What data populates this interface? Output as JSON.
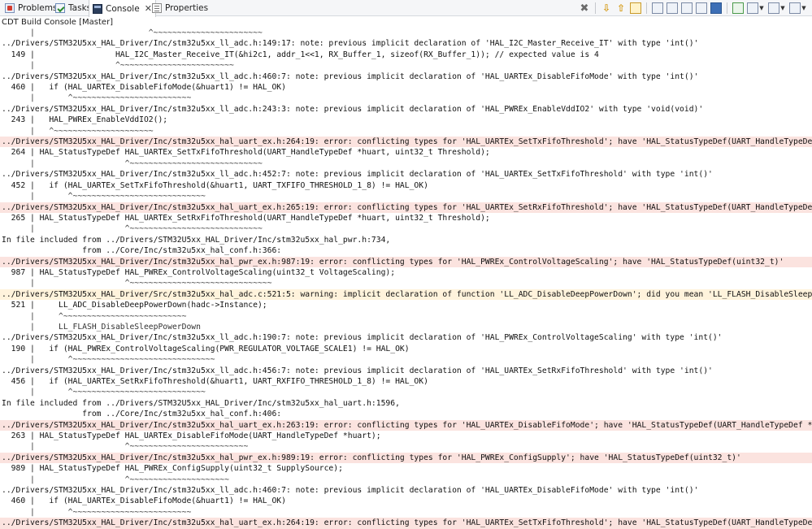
{
  "tabs": [
    {
      "label": "Problems",
      "icon": "problems-icon",
      "active": false
    },
    {
      "label": "Tasks",
      "icon": "tasks-icon",
      "active": false
    },
    {
      "label": "Console",
      "icon": "console-icon",
      "active": true,
      "close": "✕"
    },
    {
      "label": "Properties",
      "icon": "properties-icon",
      "active": false
    }
  ],
  "toolbar": {
    "icons": [
      "terminate-icon",
      "scroll-lock-down-icon",
      "scroll-lock-up-icon",
      "link-icon",
      "clear-console-icon",
      "pin-console-icon",
      "word-wrap-icon",
      "copy-icon",
      "paste-icon",
      "show-console-icon",
      "open-console-icon",
      "display-selected-console-icon",
      "new-console-icon"
    ]
  },
  "console_title": "CDT Build Console [Master]",
  "lines": [
    {
      "kind": "hint",
      "text": "      |                        ^~~~~~~~~~~~~~~~~~~~~~~~"
    },
    {
      "kind": "note",
      "text": "../Drivers/STM32U5xx_HAL_Driver/Inc/stm32u5xx_ll_adc.h:149:17: note: previous implicit declaration of 'HAL_I2C_Master_Receive_IT' with type 'int()'"
    },
    {
      "kind": "code",
      "text": "  149 |                 HAL_I2C_Master_Receive_IT(&hi2c1, addr_1<<1, RX_Buffer_1, sizeof(RX_Buffer_1)); // expected value is 4"
    },
    {
      "kind": "hint",
      "text": "      |                 ^~~~~~~~~~~~~~~~~~~~~~~~~"
    },
    {
      "kind": "note",
      "text": "../Drivers/STM32U5xx_HAL_Driver/Inc/stm32u5xx_ll_adc.h:460:7: note: previous implicit declaration of 'HAL_UARTEx_DisableFifoMode' with type 'int()'"
    },
    {
      "kind": "code",
      "text": "  460 |   if (HAL_UARTEx_DisableFifoMode(&huart1) != HAL_OK)"
    },
    {
      "kind": "hint",
      "text": "      |       ^~~~~~~~~~~~~~~~~~~~~~~~~~"
    },
    {
      "kind": "note",
      "text": "../Drivers/STM32U5xx_HAL_Driver/Inc/stm32u5xx_ll_adc.h:243:3: note: previous implicit declaration of 'HAL_PWREx_EnableVddIO2' with type 'void(void)'"
    },
    {
      "kind": "code",
      "text": "  243 |   HAL_PWREx_EnableVddIO2();"
    },
    {
      "kind": "hint",
      "text": "      |   ^~~~~~~~~~~~~~~~~~~~~~"
    },
    {
      "kind": "error",
      "text": "../Drivers/STM32U5xx_HAL_Driver/Inc/stm32u5xx_hal_uart_ex.h:264:19: error: conflicting types for 'HAL_UARTEx_SetTxFifoThreshold'; have 'HAL_StatusTypeDef(UART_HandleTypeDef *, uint32_t)'"
    },
    {
      "kind": "code",
      "text": "  264 | HAL_StatusTypeDef HAL_UARTEx_SetTxFifoThreshold(UART_HandleTypeDef *huart, uint32_t Threshold);"
    },
    {
      "kind": "hint",
      "text": "      |                   ^~~~~~~~~~~~~~~~~~~~~~~~~~~~~"
    },
    {
      "kind": "note",
      "text": "../Drivers/STM32U5xx_HAL_Driver/Inc/stm32u5xx_ll_adc.h:452:7: note: previous implicit declaration of 'HAL_UARTEx_SetTxFifoThreshold' with type 'int()'"
    },
    {
      "kind": "code",
      "text": "  452 |   if (HAL_UARTEx_SetTxFifoThreshold(&huart1, UART_TXFIFO_THRESHOLD_1_8) != HAL_OK)"
    },
    {
      "kind": "hint",
      "text": "      |       ^~~~~~~~~~~~~~~~~~~~~~~~~~~~~"
    },
    {
      "kind": "error",
      "text": "../Drivers/STM32U5xx_HAL_Driver/Inc/stm32u5xx_hal_uart_ex.h:265:19: error: conflicting types for 'HAL_UARTEx_SetRxFifoThreshold'; have 'HAL_StatusTypeDef(UART_HandleTypeDef *, uint32_t)'"
    },
    {
      "kind": "code",
      "text": "  265 | HAL_StatusTypeDef HAL_UARTEx_SetRxFifoThreshold(UART_HandleTypeDef *huart, uint32_t Threshold);"
    },
    {
      "kind": "hint",
      "text": "      |                   ^~~~~~~~~~~~~~~~~~~~~~~~~~~~~"
    },
    {
      "kind": "info",
      "text": "In file included from ../Drivers/STM32U5xx_HAL_Driver/Inc/stm32u5xx_hal_pwr.h:734,"
    },
    {
      "kind": "info",
      "text": "                 from ../Core/Inc/stm32u5xx_hal_conf.h:366:"
    },
    {
      "kind": "error",
      "text": "../Drivers/STM32U5xx_HAL_Driver/Inc/stm32u5xx_hal_pwr_ex.h:987:19: error: conflicting types for 'HAL_PWREx_ControlVoltageScaling'; have 'HAL_StatusTypeDef(uint32_t)'"
    },
    {
      "kind": "code",
      "text": "  987 | HAL_StatusTypeDef HAL_PWREx_ControlVoltageScaling(uint32_t VoltageScaling);"
    },
    {
      "kind": "hint",
      "text": "      |                   ^~~~~~~~~~~~~~~~~~~~~~~~~~~~~~~"
    },
    {
      "kind": "warning",
      "text": "../Drivers/STM32U5xx_HAL_Driver/Src/stm32u5xx_hal_adc.c:521:5: warning: implicit declaration of function 'LL_ADC_DisableDeepPowerDown'; did you mean 'LL_FLASH_DisableSleepPowerDown'?"
    },
    {
      "kind": "code",
      "text": "  521 |     LL_ADC_DisableDeepPowerDown(hadc->Instance);"
    },
    {
      "kind": "hint",
      "text": "      |     ^~~~~~~~~~~~~~~~~~~~~~~~~~~"
    },
    {
      "kind": "hint",
      "text": "      |     LL_FLASH_DisableSleepPowerDown"
    },
    {
      "kind": "note",
      "text": "../Drivers/STM32U5xx_HAL_Driver/Inc/stm32u5xx_ll_adc.h:190:7: note: previous implicit declaration of 'HAL_PWREx_ControlVoltageScaling' with type 'int()'"
    },
    {
      "kind": "code",
      "text": "  190 |   if (HAL_PWREx_ControlVoltageScaling(PWR_REGULATOR_VOLTAGE_SCALE1) != HAL_OK)"
    },
    {
      "kind": "hint",
      "text": "      |       ^~~~~~~~~~~~~~~~~~~~~~~~~~~~~~~"
    },
    {
      "kind": "note",
      "text": "../Drivers/STM32U5xx_HAL_Driver/Inc/stm32u5xx_ll_adc.h:456:7: note: previous implicit declaration of 'HAL_UARTEx_SetRxFifoThreshold' with type 'int()'"
    },
    {
      "kind": "code",
      "text": "  456 |   if (HAL_UARTEx_SetRxFifoThreshold(&huart1, UART_RXFIFO_THRESHOLD_1_8) != HAL_OK)"
    },
    {
      "kind": "hint",
      "text": "      |       ^~~~~~~~~~~~~~~~~~~~~~~~~~~~~"
    },
    {
      "kind": "info",
      "text": "In file included from ../Drivers/STM32U5xx_HAL_Driver/Inc/stm32u5xx_hal_uart.h:1596,"
    },
    {
      "kind": "info",
      "text": "                 from ../Core/Inc/stm32u5xx_hal_conf.h:406:"
    },
    {
      "kind": "error",
      "text": "../Drivers/STM32U5xx_HAL_Driver/Inc/stm32u5xx_hal_uart_ex.h:263:19: error: conflicting types for 'HAL_UARTEx_DisableFifoMode'; have 'HAL_StatusTypeDef(UART_HandleTypeDef *)'"
    },
    {
      "kind": "code",
      "text": "  263 | HAL_StatusTypeDef HAL_UARTEx_DisableFifoMode(UART_HandleTypeDef *huart);"
    },
    {
      "kind": "hint",
      "text": "      |                   ^~~~~~~~~~~~~~~~~~~~~~~~~~"
    },
    {
      "kind": "error",
      "text": "../Drivers/STM32U5xx_HAL_Driver/Inc/stm32u5xx_hal_pwr_ex.h:989:19: error: conflicting types for 'HAL_PWREx_ConfigSupply'; have 'HAL_StatusTypeDef(uint32_t)'"
    },
    {
      "kind": "code",
      "text": "  989 | HAL_StatusTypeDef HAL_PWREx_ConfigSupply(uint32_t SupplySource);"
    },
    {
      "kind": "hint",
      "text": "      |                   ^~~~~~~~~~~~~~~~~~~~~~"
    },
    {
      "kind": "note",
      "text": "../Drivers/STM32U5xx_HAL_Driver/Inc/stm32u5xx_ll_adc.h:460:7: note: previous implicit declaration of 'HAL_UARTEx_DisableFifoMode' with type 'int()'"
    },
    {
      "kind": "code",
      "text": "  460 |   if (HAL_UARTEx_DisableFifoMode(&huart1) != HAL_OK)"
    },
    {
      "kind": "hint",
      "text": "      |       ^~~~~~~~~~~~~~~~~~~~~~~~~~"
    },
    {
      "kind": "error",
      "text": "../Drivers/STM32U5xx_HAL_Driver/Inc/stm32u5xx_hal_uart_ex.h:264:19: error: conflicting types for 'HAL_UARTEx_SetTxFifoThreshold'; have 'HAL_StatusTypeDef(UART_HandleTypeDef *, uint32_t)'"
    }
  ]
}
